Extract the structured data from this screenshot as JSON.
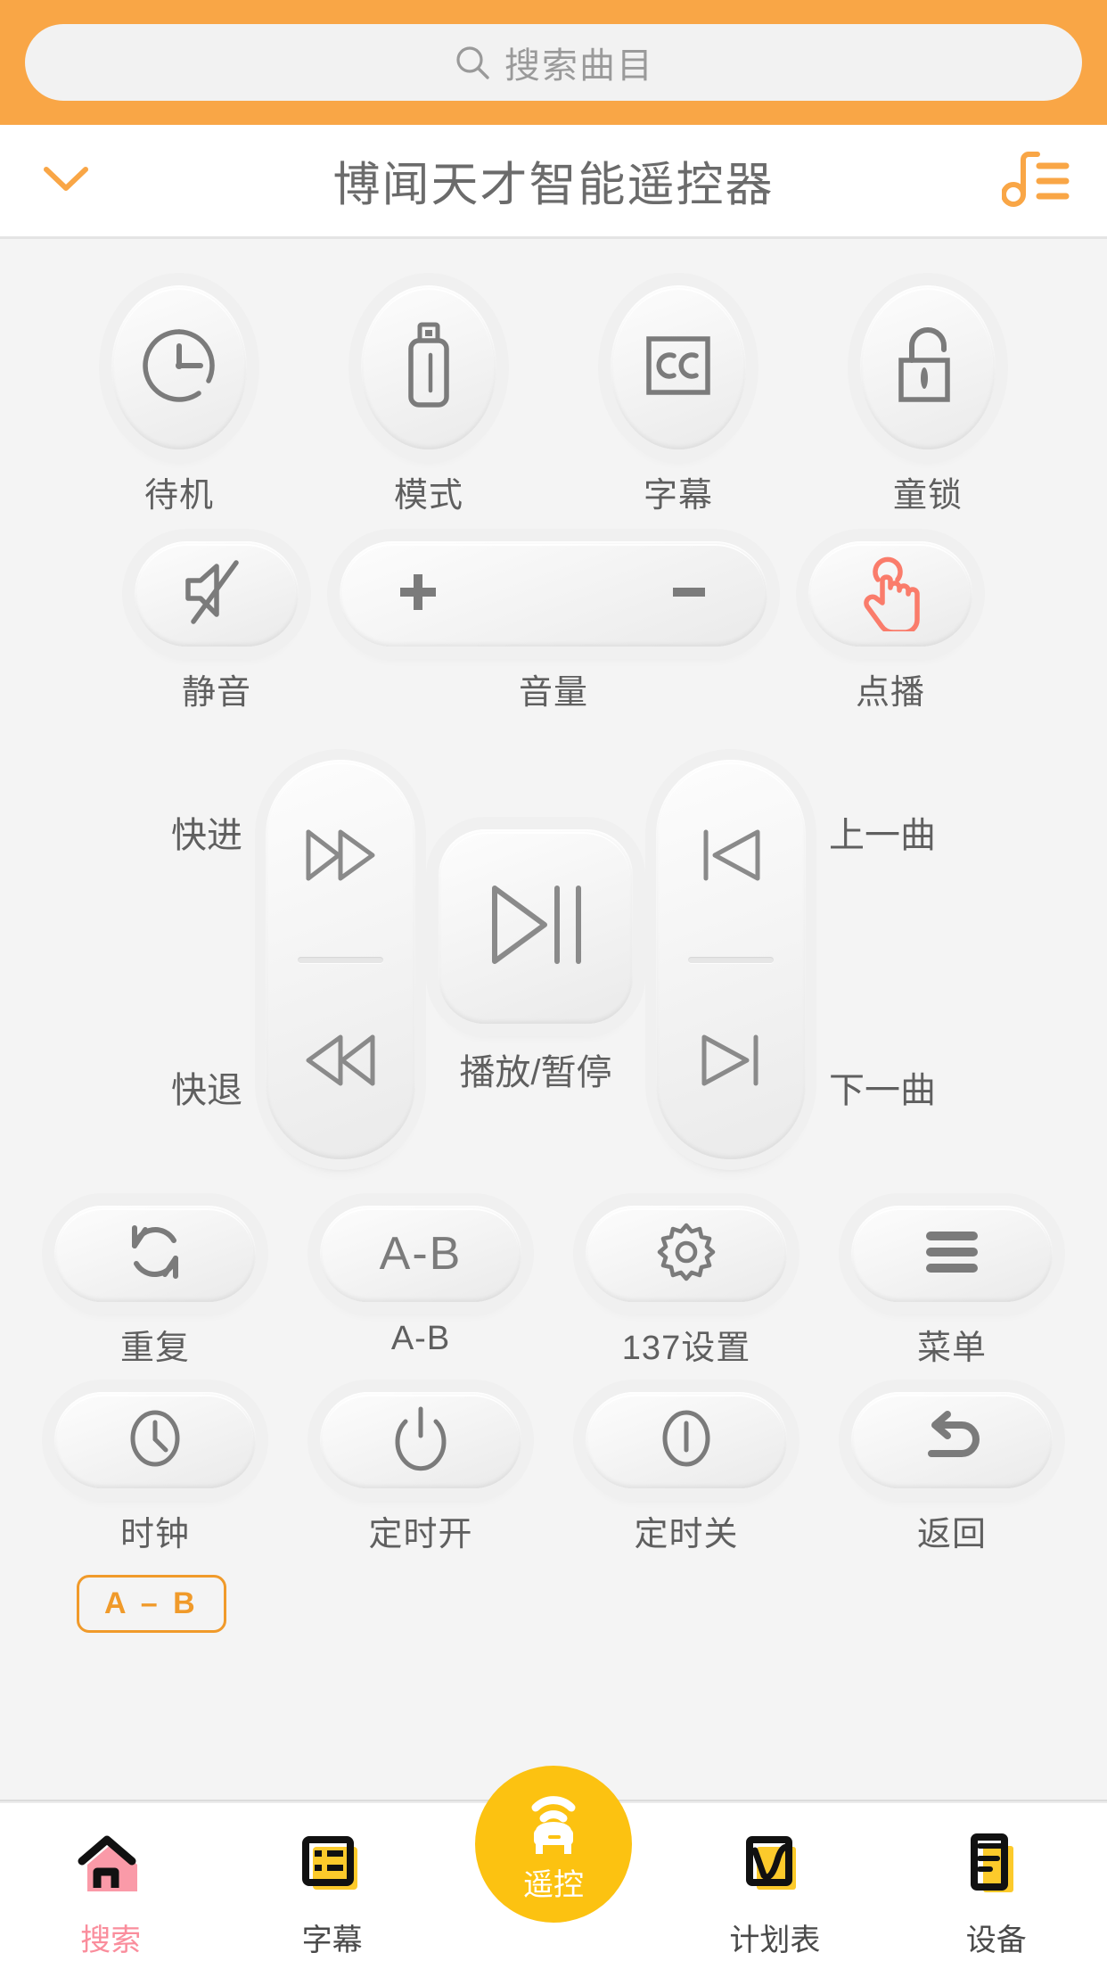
{
  "colors": {
    "orange": "#f9a646",
    "chip_orange": "#f09a2a",
    "yellow": "#fcc211",
    "pink": "#fa8d9c",
    "coral": "#fa7c6b",
    "panel_gray": "#f4f4f4",
    "icon_gray": "#7b7b7b"
  },
  "search": {
    "placeholder": "搜索曲目",
    "value": "",
    "icon": "search-icon"
  },
  "header": {
    "title": "博闻天才智能遥控器",
    "collapse_icon": "chevron-down-icon",
    "playlist_icon": "music-note-list-icon"
  },
  "remote": {
    "row1": [
      {
        "label": "待机",
        "icon": "standby-clock-icon"
      },
      {
        "label": "模式",
        "icon": "usb-drive-icon"
      },
      {
        "label": "字幕",
        "icon": "closed-caption-icon"
      },
      {
        "label": "童锁",
        "icon": "padlock-unlocked-icon"
      }
    ],
    "row2": {
      "mute": {
        "label": "静音",
        "icon": "mute-speaker-icon"
      },
      "volume": {
        "label": "音量",
        "plus": "+",
        "minus": "−",
        "plus_icon": "plus-icon",
        "minus_icon": "minus-icon"
      },
      "demand": {
        "label": "点播",
        "icon": "hand-tap-icon"
      }
    },
    "transport": {
      "left": {
        "top": {
          "label": "快进",
          "icon": "fast-forward-icon"
        },
        "bottom": {
          "label": "快退",
          "icon": "rewind-icon"
        }
      },
      "center": {
        "label": "播放/暂停",
        "icon": "play-pause-icon"
      },
      "right": {
        "top": {
          "label": "上一曲",
          "icon": "previous-track-icon"
        },
        "bottom": {
          "label": "下一曲",
          "icon": "next-track-icon"
        }
      }
    },
    "row4": [
      {
        "label": "重复",
        "icon": "repeat-icon"
      },
      {
        "label": "A-B",
        "icon": "a-b-text-icon",
        "text": "A-B"
      },
      {
        "label": "137设置",
        "icon": "gear-icon"
      },
      {
        "label": "菜单",
        "icon": "hamburger-menu-icon"
      }
    ],
    "row5": [
      {
        "label": "时钟",
        "icon": "clock-icon"
      },
      {
        "label": "定时开",
        "icon": "power-on-icon"
      },
      {
        "label": "定时关",
        "icon": "power-off-icon"
      },
      {
        "label": "返回",
        "icon": "back-arrow-icon"
      }
    ],
    "ab_chip": "A – B"
  },
  "tabbar": {
    "items": [
      {
        "label": "搜索",
        "icon": "home-icon",
        "active": true
      },
      {
        "label": "字幕",
        "icon": "subtitle-list-icon",
        "active": false
      },
      {
        "label": "遥控",
        "icon": "remote-control-icon",
        "active": true
      },
      {
        "label": "计划表",
        "icon": "schedule-chart-icon",
        "active": false
      },
      {
        "label": "设备",
        "icon": "device-book-icon",
        "active": false
      }
    ]
  }
}
